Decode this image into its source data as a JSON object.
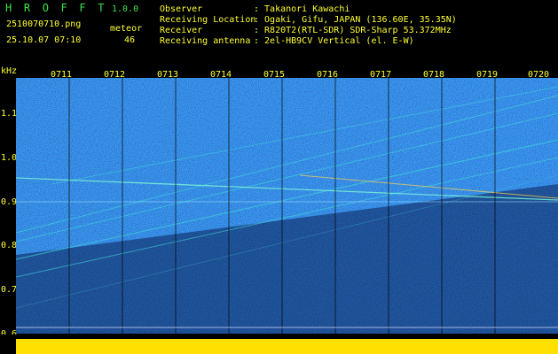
{
  "app": {
    "name": "H R O F F T",
    "version": "1.0.0"
  },
  "image": {
    "filename": "2510070710.png",
    "datetime": "25.10.07 07:10"
  },
  "meteor": {
    "label": "meteor",
    "count": "46"
  },
  "info": [
    {
      "key": "Observer",
      "value": ": Takanori Kawachi"
    },
    {
      "key": "Receiving Location",
      "value": ": Ogaki, Gifu, JAPAN (136.60E, 35.35N)"
    },
    {
      "key": "Receiver",
      "value": ": R820T2(RTL-SDR) SDR-Sharp 53.372MHz"
    },
    {
      "key": "Receiving antenna",
      "value": ": 2el-HB9CV Vertical (el. E-W)"
    }
  ],
  "axis": {
    "unit": "kHz",
    "y_ticks": [
      "1.1",
      "1.0",
      "0.9",
      "0.8",
      "0.7",
      "0.6"
    ],
    "x_ticks": [
      "0711",
      "0712",
      "0713",
      "0714",
      "0715",
      "0716",
      "0717",
      "0718",
      "0719",
      "0720"
    ]
  },
  "colors": {
    "background": "#000000",
    "label_yellow": "#ffff33",
    "label_green": "#3ee24a",
    "spectrum_base": "#0a1c7a",
    "signal_cyan": "#3fe0d8",
    "bottom_bar": "#ffe000"
  }
}
